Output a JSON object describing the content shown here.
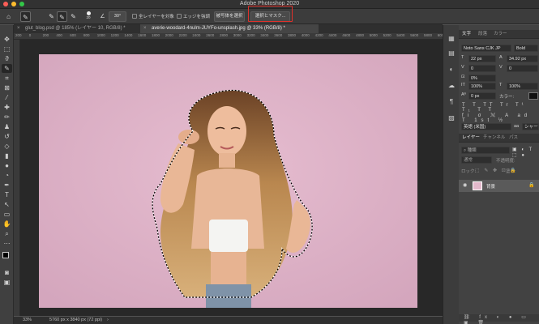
{
  "window": {
    "title": "Adobe Photoshop 2020",
    "traffic_lights": [
      "#fc5e57",
      "#fdbc2e",
      "#33c748"
    ]
  },
  "options_bar": {
    "brush_size": "20",
    "angle": "30°",
    "sample_all_layers": "全レイヤーを対象",
    "enhance_edge": "エッジを強調",
    "select_subject": "被写体を選択",
    "select_and_mask": "選択とマスク..."
  },
  "tabs": [
    {
      "label": "glut_blog.psd @ 185% (レイヤー 10, RGB/8) *",
      "active": false
    },
    {
      "label": "averie-woodard-4nulm-JUYFo-unsplash.jpg @ 33% (RGB/8) *",
      "active": true
    }
  ],
  "ruler_ticks": [
    "200",
    "0",
    "200",
    "400",
    "600",
    "800",
    "1000",
    "1200",
    "1400",
    "1600",
    "1800",
    "2000",
    "2200",
    "2400",
    "2600",
    "2800",
    "3000",
    "3200",
    "3400",
    "3600",
    "3800",
    "4000",
    "4200",
    "4400",
    "4600",
    "4800",
    "5000",
    "5200",
    "5400",
    "5600",
    "5800",
    "6000"
  ],
  "status": {
    "zoom": "33%",
    "doc_size": "5760 px x 3840 px (72 ppi)"
  },
  "character_panel": {
    "tabs": [
      "文字",
      "段落",
      "カラー"
    ],
    "font_family": "Noto Sans CJK JP",
    "font_style": "Bold",
    "font_size": "22 px",
    "leading": "34.92 px",
    "kerning": "0",
    "tracking": "0",
    "tsume": "0%",
    "vertical_scale": "100%",
    "horizontal_scale": "100%",
    "baseline_shift": "0 px",
    "color_label": "カラー:",
    "language": "英語 (米国)",
    "antialias": "シャープ"
  },
  "layers_panel": {
    "tabs": [
      "レイヤー",
      "チャンネル",
      "パス"
    ],
    "filter_placeholder": "種類",
    "blend_mode": "通常",
    "opacity_label": "不透明度:",
    "lock_label": "ロック:",
    "fill_label": "塗り:",
    "layers": [
      {
        "name": "背景",
        "visible": true
      }
    ]
  },
  "colors": {
    "highlight_box": "#e0312b",
    "backdrop": "#ddb3c8"
  }
}
